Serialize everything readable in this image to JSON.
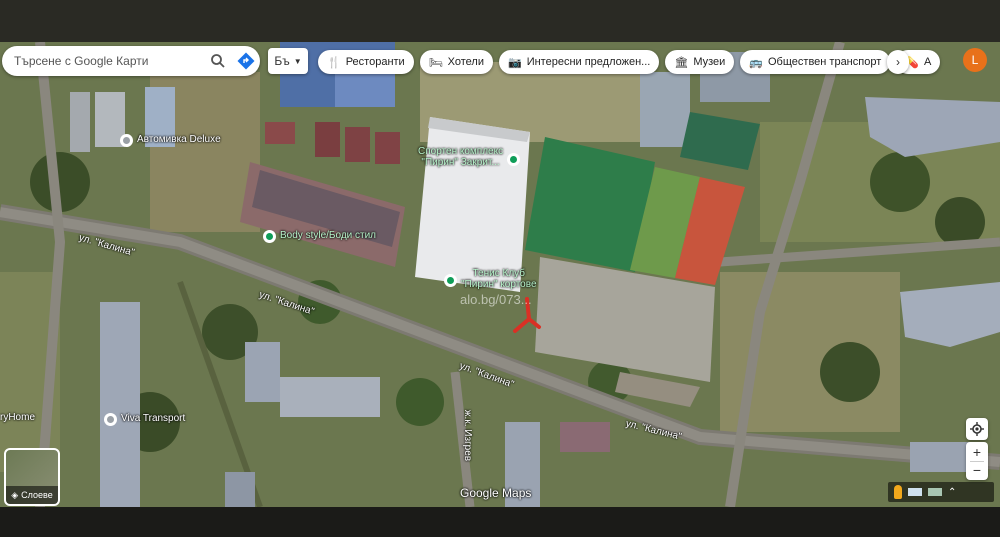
{
  "search": {
    "placeholder": "Търсене с Google Карти"
  },
  "language": {
    "label": "Бъ"
  },
  "chips": [
    {
      "icon": "fork-knife-icon",
      "glyph": "🍴",
      "label": "Ресторанти"
    },
    {
      "icon": "bed-icon",
      "glyph": "🛏",
      "label": "Хотели"
    },
    {
      "icon": "camera-icon",
      "glyph": "📷",
      "label": "Интересни предложен..."
    },
    {
      "icon": "museum-icon",
      "glyph": "🏛",
      "label": "Музеи"
    },
    {
      "icon": "bus-icon",
      "glyph": "🚌",
      "label": "Обществен транспорт"
    },
    {
      "icon": "pharmacy-icon",
      "glyph": "💊",
      "label": "А"
    }
  ],
  "user": {
    "initial": "L",
    "avatar_color": "#e8711a"
  },
  "places": [
    {
      "name": "poi-car-wash",
      "line1": "Автомивка Deluxe",
      "line2": "",
      "color": "#9aa0a6"
    },
    {
      "name": "poi-sports-complex",
      "line1": "Спортен комплекс",
      "line2": "\"Пирин\" Закрит...",
      "color": "#0f9d58"
    },
    {
      "name": "poi-body-style",
      "line1": "Body style/Боди стил",
      "line2": "",
      "color": "#0f9d58"
    },
    {
      "name": "poi-tennis-club",
      "line1": "Тенис Клуб",
      "line2": "\"Пирин\" кортове",
      "color": "#0f9d58"
    },
    {
      "name": "poi-viva-transport",
      "line1": "Viva Transport",
      "line2": "",
      "color": "#9aa0a6"
    },
    {
      "name": "poi-home",
      "line1": "ryHome",
      "line2": "",
      "color": "#9aa0a6"
    }
  ],
  "streets": {
    "kalina_1": "ул. \"Калина\"",
    "kalina_2": "ул. \"Калина\"",
    "kalina_3": "ул. \"Калина\"",
    "kalina_4": "ул. \"Калина\"",
    "izgrev": "ж.к. Изгрев"
  },
  "watermark": "alo.bg/073...",
  "layers": {
    "label": "Слоеве"
  },
  "attribution": "Google Maps",
  "accent_colors": {
    "poi_green": "#0f9d58",
    "marker_red": "#d93025",
    "pitch_green": "#2e7d4a",
    "clay_red": "#c8553d"
  }
}
